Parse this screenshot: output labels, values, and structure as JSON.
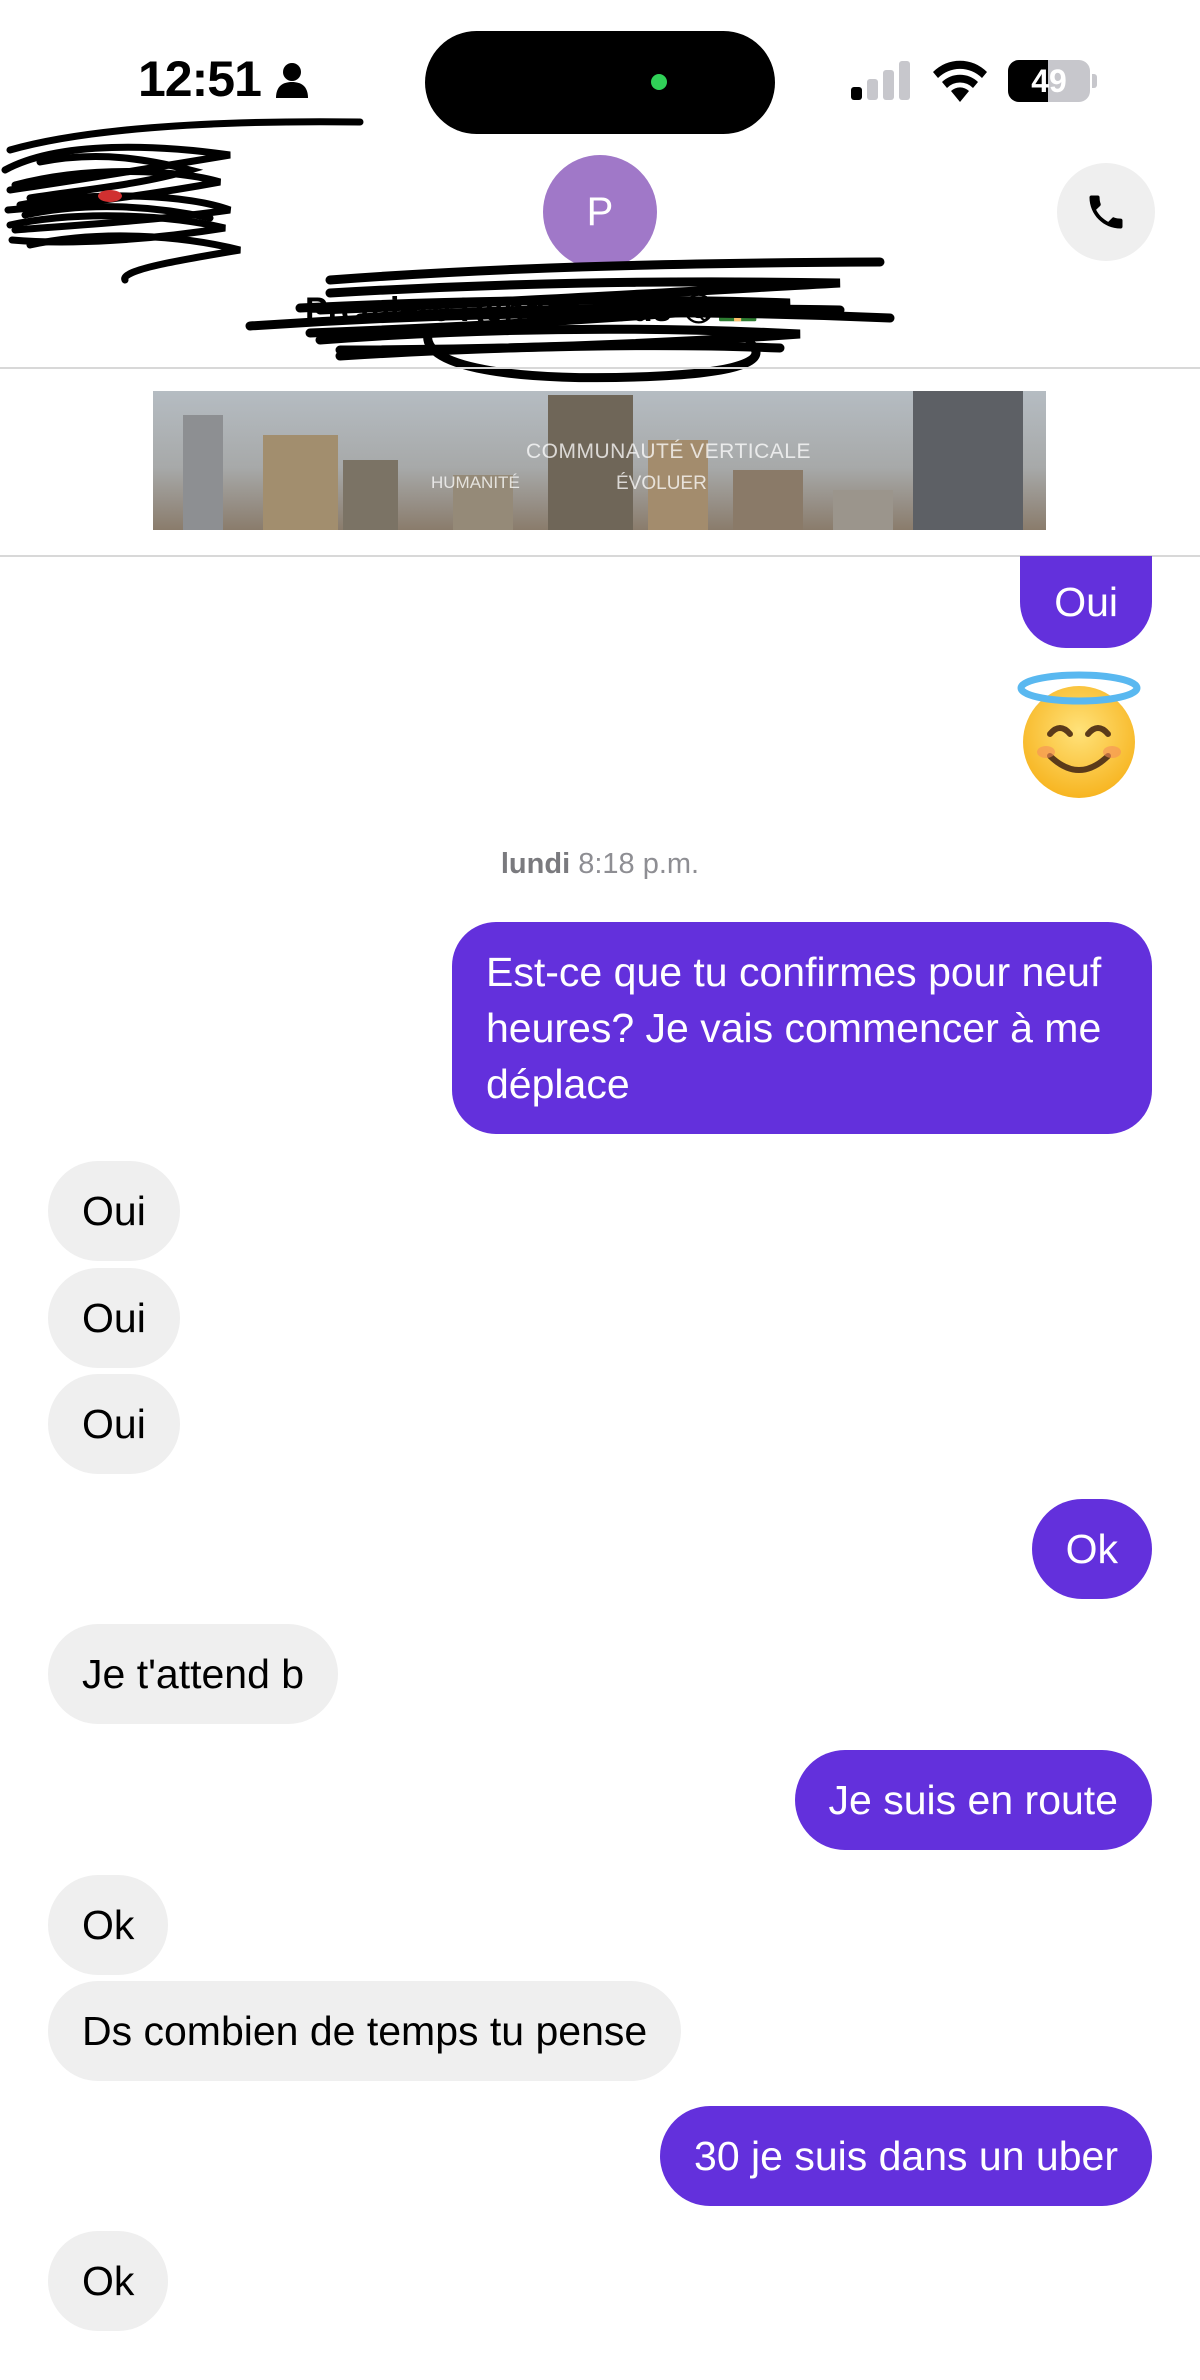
{
  "status_bar": {
    "time": "12:51",
    "battery_level": "49",
    "battery_fraction": 0.49
  },
  "header": {
    "avatar_initial": "P",
    "contact_name": "Premiere Rendez-vous 😋💵"
  },
  "banner": {
    "line1": "COMMUNAUTÉ VERTICALE",
    "line2": "HUMANITÉ",
    "line3": "ÉVOLUER"
  },
  "conversation": {
    "top_sent_1": "Oui",
    "emoji": "😇",
    "timestamp_day": "lundi",
    "timestamp_time": "8:18 p.m.",
    "messages": [
      {
        "from": "me",
        "text": "Est-ce que tu confirmes pour neuf heures? Je vais commencer à me déplace"
      },
      {
        "from": "them",
        "text": "Oui"
      },
      {
        "from": "them",
        "text": "Oui"
      },
      {
        "from": "them",
        "text": "Oui"
      },
      {
        "from": "me",
        "text": "Ok"
      },
      {
        "from": "them",
        "text": "Je t'attend b"
      },
      {
        "from": "me",
        "text": "Je suis en route"
      },
      {
        "from": "them",
        "text": "Ok"
      },
      {
        "from": "them",
        "text": "Ds combien de temps tu pense"
      },
      {
        "from": "me",
        "text": "30 je suis dans un uber"
      },
      {
        "from": "them",
        "text": "Ok"
      }
    ]
  },
  "colors": {
    "sent_bubble": "#6330dc",
    "received_bubble": "#efefef",
    "avatar": "#a078c8"
  }
}
